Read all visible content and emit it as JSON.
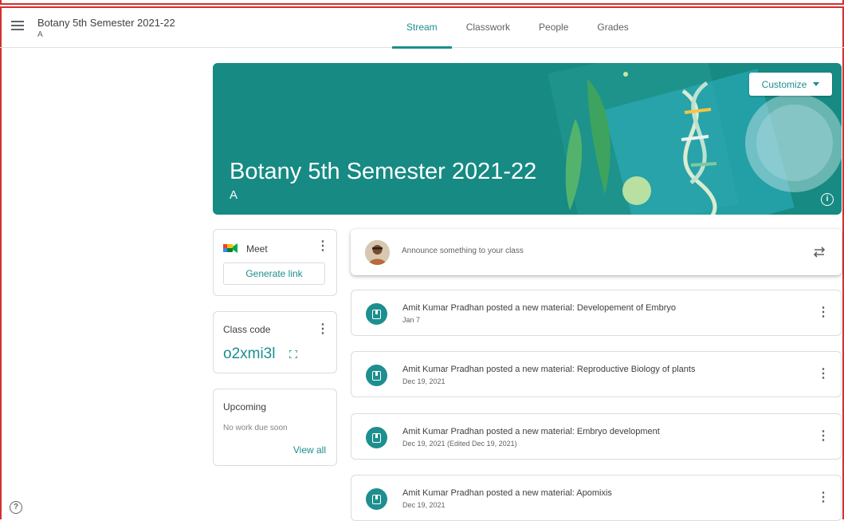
{
  "header": {
    "class_title": "Botany 5th Semester 2021-22",
    "class_section": "A",
    "tabs": [
      {
        "label": "Stream",
        "active": true
      },
      {
        "label": "Classwork",
        "active": false
      },
      {
        "label": "People",
        "active": false
      },
      {
        "label": "Grades",
        "active": false
      }
    ]
  },
  "banner": {
    "title": "Botany 5th Semester 2021-22",
    "section": "A",
    "customize_label": "Customize",
    "info_symbol": "i",
    "color": "#168a83"
  },
  "sidebar": {
    "meet": {
      "title": "Meet",
      "button_label": "Generate link"
    },
    "class_code": {
      "title": "Class code",
      "code": "o2xmi3l"
    },
    "upcoming": {
      "title": "Upcoming",
      "empty_text": "No work due soon",
      "view_all_label": "View all"
    }
  },
  "stream": {
    "announce_placeholder": "Announce something to your class",
    "posts": [
      {
        "title": "Amit Kumar Pradhan posted a new material: Developement of Embryo",
        "date": "Jan 7"
      },
      {
        "title": "Amit Kumar Pradhan posted a new material: Reproductive Biology of plants",
        "date": "Dec 19, 2021"
      },
      {
        "title": "Amit Kumar Pradhan posted a new material: Embryo development",
        "date": "Dec 19, 2021 (Edited Dec 19, 2021)"
      },
      {
        "title": "Amit Kumar Pradhan posted a new material: Apomixis",
        "date": "Dec 19, 2021"
      }
    ]
  },
  "help_symbol": "?",
  "accent_color": "#1e8e8e"
}
